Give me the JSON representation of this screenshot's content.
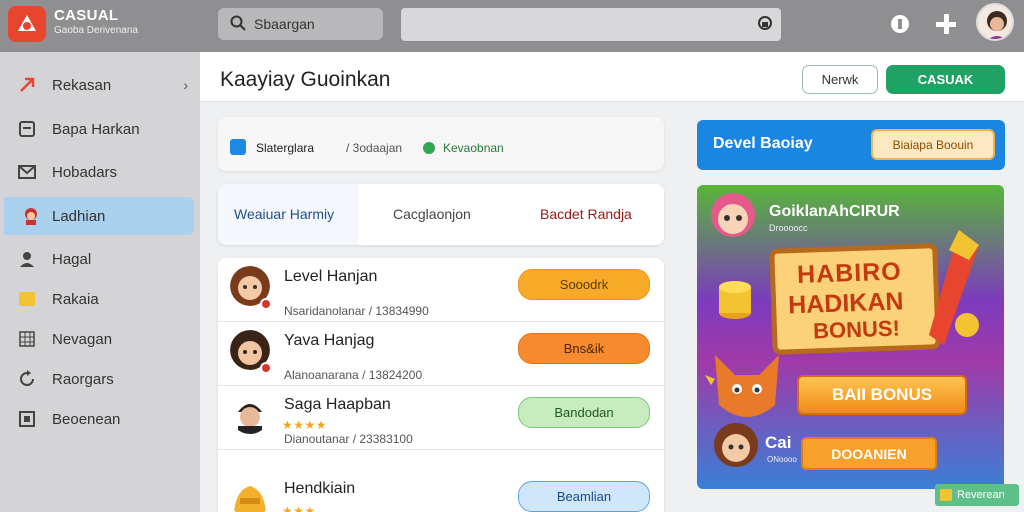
{
  "brand": {
    "title": "CASUAL",
    "subtitle": "Gaoba Derivenana"
  },
  "topbar": {
    "search_label": "Sbaargan",
    "search_value": ""
  },
  "sidebar": {
    "items": [
      {
        "label": "Rekasan",
        "icon": "arrow-icon"
      },
      {
        "label": "Bapa Harkan",
        "icon": "document-icon"
      },
      {
        "label": "Hobadars",
        "icon": "mail-icon"
      },
      {
        "label": "Ladhian",
        "icon": "character-icon",
        "active": true
      },
      {
        "label": "Hagal",
        "icon": "user-icon"
      },
      {
        "label": "Rakaia",
        "icon": "folder-icon"
      },
      {
        "label": "Nevagan",
        "icon": "grid-icon"
      },
      {
        "label": "Raorgars",
        "icon": "refresh-icon"
      },
      {
        "label": "Beoenean",
        "icon": "box-icon"
      }
    ]
  },
  "main": {
    "title": "Kaayiay Guoinkan",
    "news_button": "Nerwk",
    "casual_button": "CASUAK"
  },
  "filters": {
    "item1": "Slaterglara",
    "item2": "/ 3odaajan",
    "item3": "Kevaobnan"
  },
  "tabs": [
    "Weaiuar Harmiy",
    "Cacglaonjon",
    "Bacdet Randja"
  ],
  "list": [
    {
      "name": "Level Hanjan",
      "sub": "Nsaridanolanar / 13834990",
      "action": "Sooodrk",
      "style": "orange1"
    },
    {
      "name": "Yava Hanjag",
      "sub": "Alanoanarana / 13824200",
      "action": "Bns&ik",
      "style": "orange2"
    },
    {
      "name": "Saga Haapban",
      "sub": "Dianoutanar / 23383100",
      "action": "Bandodan",
      "style": "green",
      "stars": "★★★★"
    },
    {
      "name": "Hendkiain",
      "sub": "",
      "action": "Beamlian",
      "style": "blue",
      "stars": "★★★"
    }
  ],
  "level_box": {
    "title": "Devel Baoiay",
    "button": "Biaiapa Boouin"
  },
  "promo": {
    "title": "GoiklanAhCIRUR",
    "subtitle": "Droooocc",
    "board_line1": "HABIRO",
    "board_line2": "HADIKAN",
    "board_line3": "BONUS!",
    "bonus_button": "BAII BONUS",
    "ca_label": "Cai",
    "ca_sub": "ONoooo",
    "do_button": "DOOANIEN"
  },
  "reward_chip": "Reverean",
  "colors": {
    "accent_green": "#1ea365",
    "accent_blue": "#1b86e2",
    "accent_orange": "#f7a928",
    "brand_red": "#e8452f"
  }
}
